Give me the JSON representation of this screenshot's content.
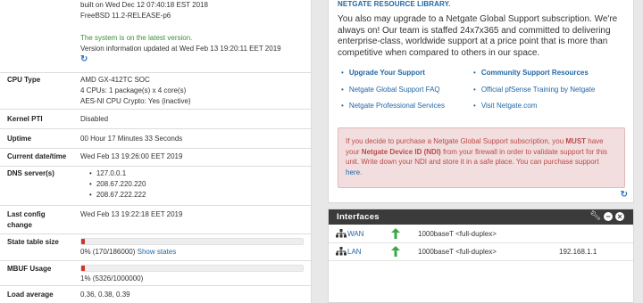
{
  "version": {
    "built": "built on Wed Dec 12 07:40:18 EST 2018",
    "os": "FreeBSD 11.2-RELEASE-p6",
    "status": "The system is on the latest version.",
    "updated": "Version information updated at Wed Feb 13 19:20:11 EET 2019",
    "refresh_icon": "refresh-icon"
  },
  "cpu": {
    "label": "CPU Type",
    "lines": [
      "AMD GX-412TC SOC",
      "4 CPUs: 1 package(s) x 4 core(s)",
      "AES-NI CPU Crypto: Yes (inactive)"
    ]
  },
  "kernel_pti": {
    "label": "Kernel PTI",
    "value": "Disabled"
  },
  "uptime": {
    "label": "Uptime",
    "value": "00 Hour 17 Minutes 33 Seconds"
  },
  "current_date": {
    "label": "Current date/time",
    "value": "Wed Feb 13 19:26:00 EET 2019"
  },
  "dns": {
    "label": "DNS server(s)",
    "servers": [
      "127.0.0.1",
      "208.67.220.220",
      "208.67.222.222"
    ]
  },
  "last_config": {
    "label_line1": "Last config",
    "label_line2": "change",
    "value": "Wed Feb 13 19:22:18 EET 2019"
  },
  "state_table": {
    "label": "State table size",
    "text": "0% (170/186000)",
    "link": "Show states",
    "fill_fraction": 0.0009
  },
  "mbuf": {
    "label": "MBUF Usage",
    "text": "1% (5326/1000000)",
    "fill_fraction": 0.0053
  },
  "load": {
    "label": "Load average",
    "value": "0.36, 0.38, 0.39"
  },
  "resource": {
    "title": "NETGATE RESOURCE LIBRARY.",
    "paragraph": "You also may upgrade to a Netgate Global Support subscription. We're always on! Our team is staffed 24x7x365 and committed to delivering enterprise-class, worldwide support at a price point that is more than competitive when compared to others in our space.",
    "links": [
      "Upgrade Your Support",
      "Community Support Resources",
      "Netgate Global Support FAQ",
      "Official pfSense Training by Netgate",
      "Netgate Professional Services",
      "Visit Netgate.com"
    ],
    "alert": {
      "p1": "If you decide to purchase a Netgate Global Support subscription, you ",
      "must": "MUST",
      "p2": " have your ",
      "ndi": "Netgate Device ID (NDI)",
      "p3": " from your firewall in order to validate support for this unit. Write down your NDI and store it in a safe place. You can purchase support ",
      "here": "here",
      "p4": "."
    }
  },
  "interfaces": {
    "title": "Interfaces",
    "rows": [
      {
        "name": "WAN",
        "media": "1000baseT <full-duplex>",
        "ip": ""
      },
      {
        "name": "LAN",
        "media": "1000baseT <full-duplex>",
        "ip": "192.168.1.1"
      }
    ]
  },
  "colors": {
    "link": "#2067a6",
    "success": "#3c8f3c",
    "alert_bg": "#f2dede",
    "alert_text": "#b94a48",
    "header_dark": "#3b3b3b",
    "up_arrow": "#3aa845",
    "bar_fill": "#d0352c"
  }
}
